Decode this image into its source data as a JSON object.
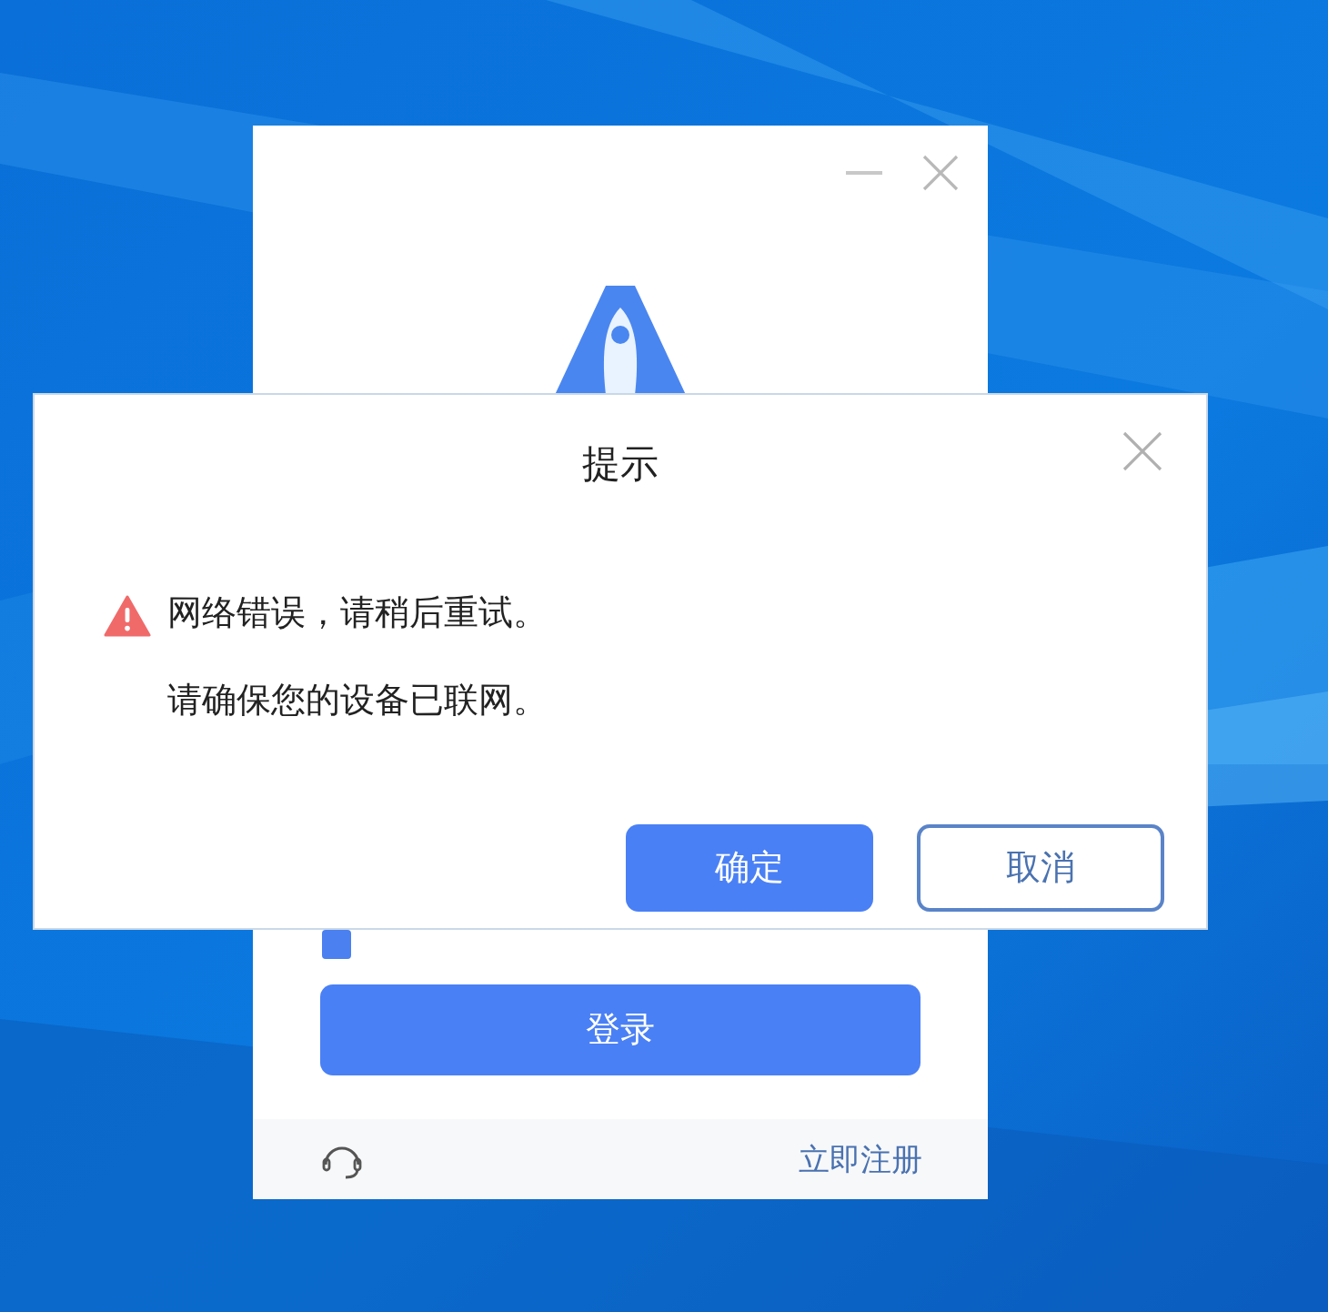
{
  "login_window": {
    "remember_checkbox": {
      "checked": true
    },
    "login_button": "登录",
    "register_link": "立即注册"
  },
  "dialog": {
    "title": "提示",
    "messages": [
      {
        "kind": "error",
        "text": "网络错误，请稍后重试。"
      },
      {
        "kind": "hint",
        "text": "请确保您的设备已联网。"
      }
    ],
    "buttons": [
      {
        "kind": "primary",
        "label": "确定"
      },
      {
        "kind": "secondary",
        "label": "取消"
      }
    ]
  }
}
